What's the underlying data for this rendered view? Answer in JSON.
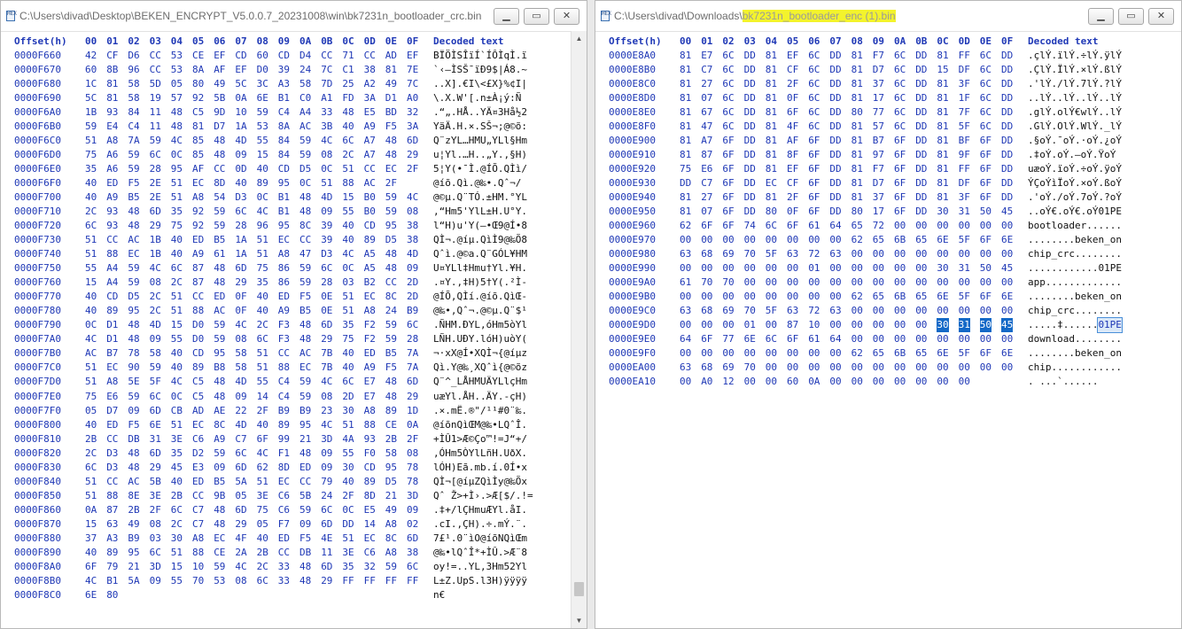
{
  "left": {
    "title": "C:\\Users\\divad\\Desktop\\BEKEN_ENCRYPT_V5.0.0.7_20231008\\win\\bk7231n_bootloader_crc.bin",
    "header": {
      "offset": "Offset(h)",
      "cols": [
        "00",
        "01",
        "02",
        "03",
        "04",
        "05",
        "06",
        "07",
        "08",
        "09",
        "0A",
        "0B",
        "0C",
        "0D",
        "0E",
        "0F"
      ],
      "decoded": "Decoded text"
    },
    "scroll_position": 0.97,
    "rows": [
      {
        "o": "0000F660",
        "b": "42 CF D6 CC 53 CE EF CD 60 CD D4 CC 71 CC AD EF",
        "t": "BÏÖÌSÎïÍ`ÍÔÌqÌ.ï"
      },
      {
        "o": "0000F670",
        "b": "60 8B 96 CC 53 8A AF EF D0 39 24 7C C1 38 81 7E",
        "t": "`‹–ÌSŠ¯ïÐ9$|Á8.~"
      },
      {
        "o": "0000F680",
        "b": "1C 81 58 5D 05 80 49 5C 3C A3 58 7D 25 A2 49 7C",
        "t": "..X].€I\\<£X}%¢I|"
      },
      {
        "o": "0000F690",
        "b": "5C 81 58 19 57 92 5B 0A 6E B1 C0 A1 FD 3A D1 A0",
        "t": "\\.X.W'[.n±À¡ý:Ñ "
      },
      {
        "o": "0000F6A0",
        "b": "1B 93 84 11 48 C5 9D 10 59 C4 A4 33 48 E5 BD 32",
        "t": ".“„.HÅ..YÄ¤3Hå½2"
      },
      {
        "o": "0000F6B0",
        "b": "59 E4 C4 11 48 81 D7 1A 53 8A AC 3B 40 A9 F5 3A",
        "t": "YäÄ.H.×.SŠ¬;@©õ:"
      },
      {
        "o": "0000F6C0",
        "b": "51 A8 7A 59 4C 85 48 4D 55 84 59 4C 6C A7 48 6D",
        "t": "Q¨zYL…HMU„YLl§Hm"
      },
      {
        "o": "0000F6D0",
        "b": "75 A6 59 6C 0C 85 48 09 15 84 59 08 2C A7 48 29",
        "t": "u¦Yl.…H..„Y.,§H)"
      },
      {
        "o": "0000F6E0",
        "b": "35 A6 59 28 95 AF CC 0D 40 CD D5 0C 51 CC EC 2F",
        "t": "5¦Y(•¯Ì.@ÍÕ.QÌì/"
      },
      {
        "o": "0000F6F0",
        "b": "40 ED F5 2E 51 EC 8D 40 89 95 0C 51 88 AC 2F",
        "t": "@íõ.Qì.@‰•.Qˆ¬/"
      },
      {
        "o": "0000F700",
        "b": "40 A9 B5 2E 51 A8 54 D3 0C B1 48 4D 15 B0 59 4C",
        "t": "@©µ.Q¨TÓ.±HM.°YL"
      },
      {
        "o": "0000F710",
        "b": "2C 93 48 6D 35 92 59 6C 4C B1 48 09 55 B0 59 08",
        "t": ",“Hm5'YlL±H.U°Y."
      },
      {
        "o": "0000F720",
        "b": "6C 93 48 29 75 92 59 28 96 95 8C 39 40 CD 95 38",
        "t": "l“H)u'Y(–•Œ9@Í•8"
      },
      {
        "o": "0000F730",
        "b": "51 CC AC 1B 40 ED B5 1A 51 EC CC 39 40 89 D5 38",
        "t": "QÌ¬.@íµ.QìÌ9@‰Õ8"
      },
      {
        "o": "0000F740",
        "b": "51 88 EC 1B 40 A9 61 1A 51 A8 47 D3 4C A5 48 4D",
        "t": "Qˆì.@©a.Q¨GÓL¥HM"
      },
      {
        "o": "0000F750",
        "b": "55 A4 59 4C 6C 87 48 6D 75 86 59 6C 0C A5 48 09",
        "t": "U¤YLl‡Hmu†Yl.¥H."
      },
      {
        "o": "0000F760",
        "b": "15 A4 59 08 2C 87 48 29 35 86 59 28 03 B2 CC 2D",
        "t": ".¤Y.,‡H)5†Y(.²Ì-"
      },
      {
        "o": "0000F770",
        "b": "40 CD D5 2C 51 CC ED 0F 40 ED F5 0E 51 EC 8C 2D",
        "t": "@ÍÕ,QÌí.@íõ.QìŒ-"
      },
      {
        "o": "0000F780",
        "b": "40 89 95 2C 51 88 AC 0F 40 A9 B5 0E 51 A8 24 B9",
        "t": "@‰•,Qˆ¬.@©µ.Q¨$¹"
      },
      {
        "o": "0000F790",
        "b": "0C D1 48 4D 15 D0 59 4C 2C F3 48 6D 35 F2 59 6C",
        "t": ".ÑHM.ÐYL,óHm5òYl"
      },
      {
        "o": "0000F7A0",
        "b": "4C D1 48 09 55 D0 59 08 6C F3 48 29 75 F2 59 28",
        "t": "LÑH.UÐY.lóH)uòY("
      },
      {
        "o": "0000F7B0",
        "b": "AC B7 78 58 40 CD 95 58 51 CC AC 7B 40 ED B5 7A",
        "t": "¬·xX@Í•XQÌ¬{@íµz"
      },
      {
        "o": "0000F7C0",
        "b": "51 EC 90 59 40 89 B8 58 51 88 EC 7B 40 A9 F5 7A",
        "t": "Qì.Y@‰¸XQˆì{@©õz"
      },
      {
        "o": "0000F7D0",
        "b": "51 A8 5E 5F 4C C5 48 4D 55 C4 59 4C 6C E7 48 6D",
        "t": "Q¨^_LÅHMUÄYLlçHm"
      },
      {
        "o": "0000F7E0",
        "b": "75 E6 59 6C 0C C5 48 09 14 C4 59 08 2D E7 48 29",
        "t": "uæYl.ÅH..ÄY.-çH)"
      },
      {
        "o": "0000F7F0",
        "b": "05 D7 09 6D CB AD AE 22 2F B9 B9 23 30 A8 89 1D",
        "t": ".×.mË.®\"/¹¹#0¨‰."
      },
      {
        "o": "0000F800",
        "b": "40 ED F5 6E 51 EC 8C 4D 40 89 95 4C 51 88 CE 0A",
        "t": "@íõnQìŒM@‰•LQˆÎ."
      },
      {
        "o": "0000F810",
        "b": "2B CC DB 31 3E C6 A9 C7 6F 99 21 3D 4A 93 2B 2F",
        "t": "+ÌÛ1>Æ©Ço™!=J“+/"
      },
      {
        "o": "0000F820",
        "b": "2C D3 48 6D 35 D2 59 6C 4C F1 48 09 55 F0 58 08",
        "t": ",ÓHm5ÒYlLñH.UðX."
      },
      {
        "o": "0000F830",
        "b": "6C D3 48 29 45 E3 09 6D 62 8D ED 09 30 CD 95 78",
        "t": "lÓH)Eã.mb.í.0Í•x"
      },
      {
        "o": "0000F840",
        "b": "51 CC AC 5B 40 ED B5 5A 51 EC CC 79 40 89 D5 78",
        "t": "QÌ¬[@íµZQìÌy@‰Õx"
      },
      {
        "o": "0000F850",
        "b": "51 88 8E 3E 2B CC 9B 05 3E C6 5B 24 2F 8D 21 3D",
        "t": "Qˆ Ž>+Ì›.>Æ[$/.!="
      },
      {
        "o": "0000F860",
        "b": "0A 87 2B 2F 6C C7 48 6D 75 C6 59 6C 0C E5 49 09",
        "t": ".‡+/lÇHmuÆYl.åI."
      },
      {
        "o": "0000F870",
        "b": "15 63 49 08 2C C7 48 29 05 F7 09 6D DD 14 A8 02",
        "t": ".cI.,ÇH).÷.mÝ.¨."
      },
      {
        "o": "0000F880",
        "b": "37 A3 B9 03 30 A8 EC 4F 40 ED F5 4E 51 EC 8C 6D",
        "t": "7£¹.0¨ìO@íõNQìŒm"
      },
      {
        "o": "0000F890",
        "b": "40 89 95 6C 51 88 CE 2A 2B CC DB 11 3E C6 A8 38",
        "t": "@‰•lQˆÎ*+ÌÛ.>Æ¨8"
      },
      {
        "o": "0000F8A0",
        "b": "6F 79 21 3D 15 10 59 4C 2C 33 48 6D 35 32 59 6C",
        "t": "oy!=..YL,3Hm52Yl"
      },
      {
        "o": "0000F8B0",
        "b": "4C B1 5A 09 55 70 53 08 6C 33 48 29 FF FF FF FF",
        "t": "L±Z.UpS.l3H)ÿÿÿÿ"
      },
      {
        "o": "0000F8C0",
        "b": "6E 80",
        "t": "n€"
      }
    ]
  },
  "right": {
    "title_prefix": "C:\\Users\\divad\\Downloads\\",
    "title_highlight": "bk7231n_bootloader_enc (1).bin",
    "header": {
      "offset": "Offset(h)",
      "cols": [
        "00",
        "01",
        "02",
        "03",
        "04",
        "05",
        "06",
        "07",
        "08",
        "09",
        "0A",
        "0B",
        "0C",
        "0D",
        "0E",
        "0F"
      ],
      "decoded": "Decoded text"
    },
    "selection": {
      "row": 19,
      "from_byte": 12,
      "to_byte": 15,
      "text": "01PE"
    },
    "rows": [
      {
        "o": "0000E8A0",
        "b": "81 E7 6C DD 81 EF 6C DD 81 F7 6C DD 81 FF 6C DD",
        "t": ".çlÝ.ïlÝ.÷lÝ.ÿlÝ"
      },
      {
        "o": "0000E8B0",
        "b": "81 C7 6C DD 81 CF 6C DD 81 D7 6C DD 15 DF 6C DD",
        "t": ".ÇlÝ.ÏlÝ.×lÝ.ßlÝ"
      },
      {
        "o": "0000E8C0",
        "b": "81 27 6C DD 81 2F 6C DD 81 37 6C DD 81 3F 6C DD",
        "t": ".'lÝ./lÝ.7lÝ.?lÝ"
      },
      {
        "o": "0000E8D0",
        "b": "81 07 6C DD 81 0F 6C DD 81 17 6C DD 81 1F 6C DD",
        "t": "..lÝ..lÝ..lÝ..lÝ"
      },
      {
        "o": "0000E8E0",
        "b": "81 67 6C DD 81 6F 6C DD 80 77 6C DD 81 7F 6C DD",
        "t": ".glÝ.olÝ€wlÝ..lÝ"
      },
      {
        "o": "0000E8F0",
        "b": "81 47 6C DD 81 4F 6C DD 81 57 6C DD 81 5F 6C DD",
        "t": ".GlÝ.OlÝ.WlÝ._lÝ"
      },
      {
        "o": "0000E900",
        "b": "81 A7 6F DD 81 AF 6F DD 81 B7 6F DD 81 BF 6F DD",
        "t": ".§oÝ.¯oÝ.·oÝ.¿oÝ"
      },
      {
        "o": "0000E910",
        "b": "81 87 6F DD 81 8F 6F DD 81 97 6F DD 81 9F 6F DD",
        "t": ".‡oÝ.oÝ.—oÝ.ŸoÝ"
      },
      {
        "o": "0000E920",
        "b": "75 E6 6F DD 81 EF 6F DD 81 F7 6F DD 81 FF 6F DD",
        "t": "uæoÝ.ïoÝ.÷oÝ.ÿoÝ"
      },
      {
        "o": "0000E930",
        "b": "DD C7 6F DD EC CF 6F DD 81 D7 6F DD 81 DF 6F DD",
        "t": "ÝÇoÝìÏoÝ.×oÝ.ßoÝ"
      },
      {
        "o": "0000E940",
        "b": "81 27 6F DD 81 2F 6F DD 81 37 6F DD 81 3F 6F DD",
        "t": ".'oÝ./oÝ.7oÝ.?oÝ"
      },
      {
        "o": "0000E950",
        "b": "81 07 6F DD 80 0F 6F DD 80 17 6F DD 30 31 50 45",
        "t": "..oÝ€.oÝ€.oÝ01PE"
      },
      {
        "o": "0000E960",
        "b": "62 6F 6F 74 6C 6F 61 64 65 72 00 00 00 00 00 00",
        "t": "bootloader......"
      },
      {
        "o": "0000E970",
        "b": "00 00 00 00 00 00 00 00 62 65 6B 65 6E 5F 6F 6E",
        "t": "........beken_on"
      },
      {
        "o": "0000E980",
        "b": "63 68 69 70 5F 63 72 63 00 00 00 00 00 00 00 00",
        "t": "chip_crc........"
      },
      {
        "o": "0000E990",
        "b": "00 00 00 00 00 00 01 00 00 00 00 00 30 31 50 45",
        "t": "............01PE"
      },
      {
        "o": "0000E9A0",
        "b": "61 70 70 00 00 00 00 00 00 00 00 00 00 00 00 00",
        "t": "app............."
      },
      {
        "o": "0000E9B0",
        "b": "00 00 00 00 00 00 00 00 62 65 6B 65 6E 5F 6F 6E",
        "t": "........beken_on"
      },
      {
        "o": "0000E9C0",
        "b": "63 68 69 70 5F 63 72 63 00 00 00 00 00 00 00 00",
        "t": "chip_crc........"
      },
      {
        "o": "0000E9D0",
        "b": "00 00 00 01 00 87 10 00 00 00 00 00 30 31 50 45",
        "t": ".....‡......01PE"
      },
      {
        "o": "0000E9E0",
        "b": "64 6F 77 6E 6C 6F 61 64 00 00 00 00 00 00 00 00",
        "t": "download........"
      },
      {
        "o": "0000E9F0",
        "b": "00 00 00 00 00 00 00 00 62 65 6B 65 6E 5F 6F 6E",
        "t": "........beken_on"
      },
      {
        "o": "0000EA00",
        "b": "63 68 69 70 00 00 00 00 00 00 00 00 00 00 00 00",
        "t": "chip............"
      },
      {
        "o": "0000EA10",
        "b": "00 A0 12 00 00 60 0A 00 00 00 00 00 00 00",
        "t": ". ...`......"
      }
    ]
  }
}
